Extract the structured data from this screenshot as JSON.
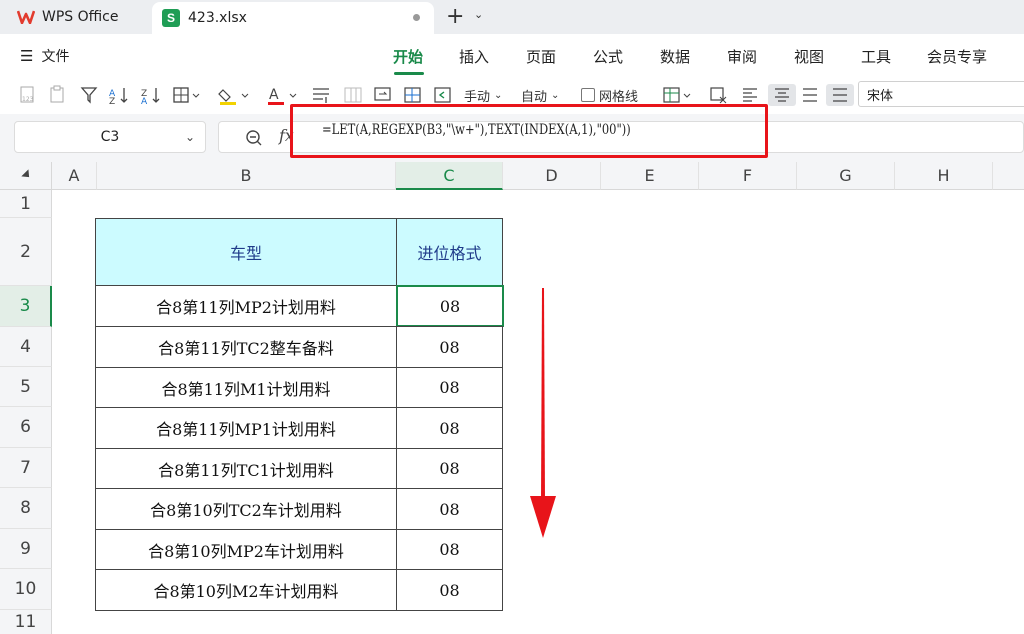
{
  "tabbar": {
    "app_name": "WPS Office",
    "file_tab": "423.xlsx",
    "new_tab": "+"
  },
  "menu": {
    "file_label": "文件",
    "tabs": [
      "开始",
      "插入",
      "页面",
      "公式",
      "数据",
      "审阅",
      "视图",
      "工具",
      "会员专享"
    ],
    "active_tab": "开始"
  },
  "toolbar": {
    "manual_label": "手动",
    "auto_label": "自动",
    "gridlines_label": "网格线",
    "font_name": "宋体"
  },
  "formula_bar": {
    "cell_ref": "C3",
    "fx": "fx",
    "formula": "=LET(A,REGEXP(B3,\"\\w+\"),TEXT(INDEX(A,1),\"00\"))"
  },
  "grid": {
    "columns": [
      "A",
      "B",
      "C",
      "D",
      "E",
      "F",
      "G",
      "H"
    ],
    "rows": [
      "1",
      "2",
      "3",
      "4",
      "5",
      "6",
      "7",
      "8",
      "9",
      "10",
      "11"
    ],
    "selected_column": "C",
    "selected_row": "3"
  },
  "table": {
    "headers": [
      "车型",
      "进位格式"
    ],
    "rows": [
      [
        "合8第11列MP2计划用料",
        "08"
      ],
      [
        "合8第11列TC2整车备料",
        "08"
      ],
      [
        "合8第11列M1计划用料",
        "08"
      ],
      [
        "合8第11列MP1计划用料",
        "08"
      ],
      [
        "合8第11列TC1计划用料",
        "08"
      ],
      [
        "合8第10列TC2车计划用料",
        "08"
      ],
      [
        "合8第10列MP2车计划用料",
        "08"
      ],
      [
        "合8第10列M2车计划用料",
        "08"
      ]
    ]
  },
  "colors": {
    "accent": "#1a8a4a",
    "highlight_box": "#e8141a",
    "header_fill": "#ccfbff",
    "arrow": "#e8141a"
  }
}
